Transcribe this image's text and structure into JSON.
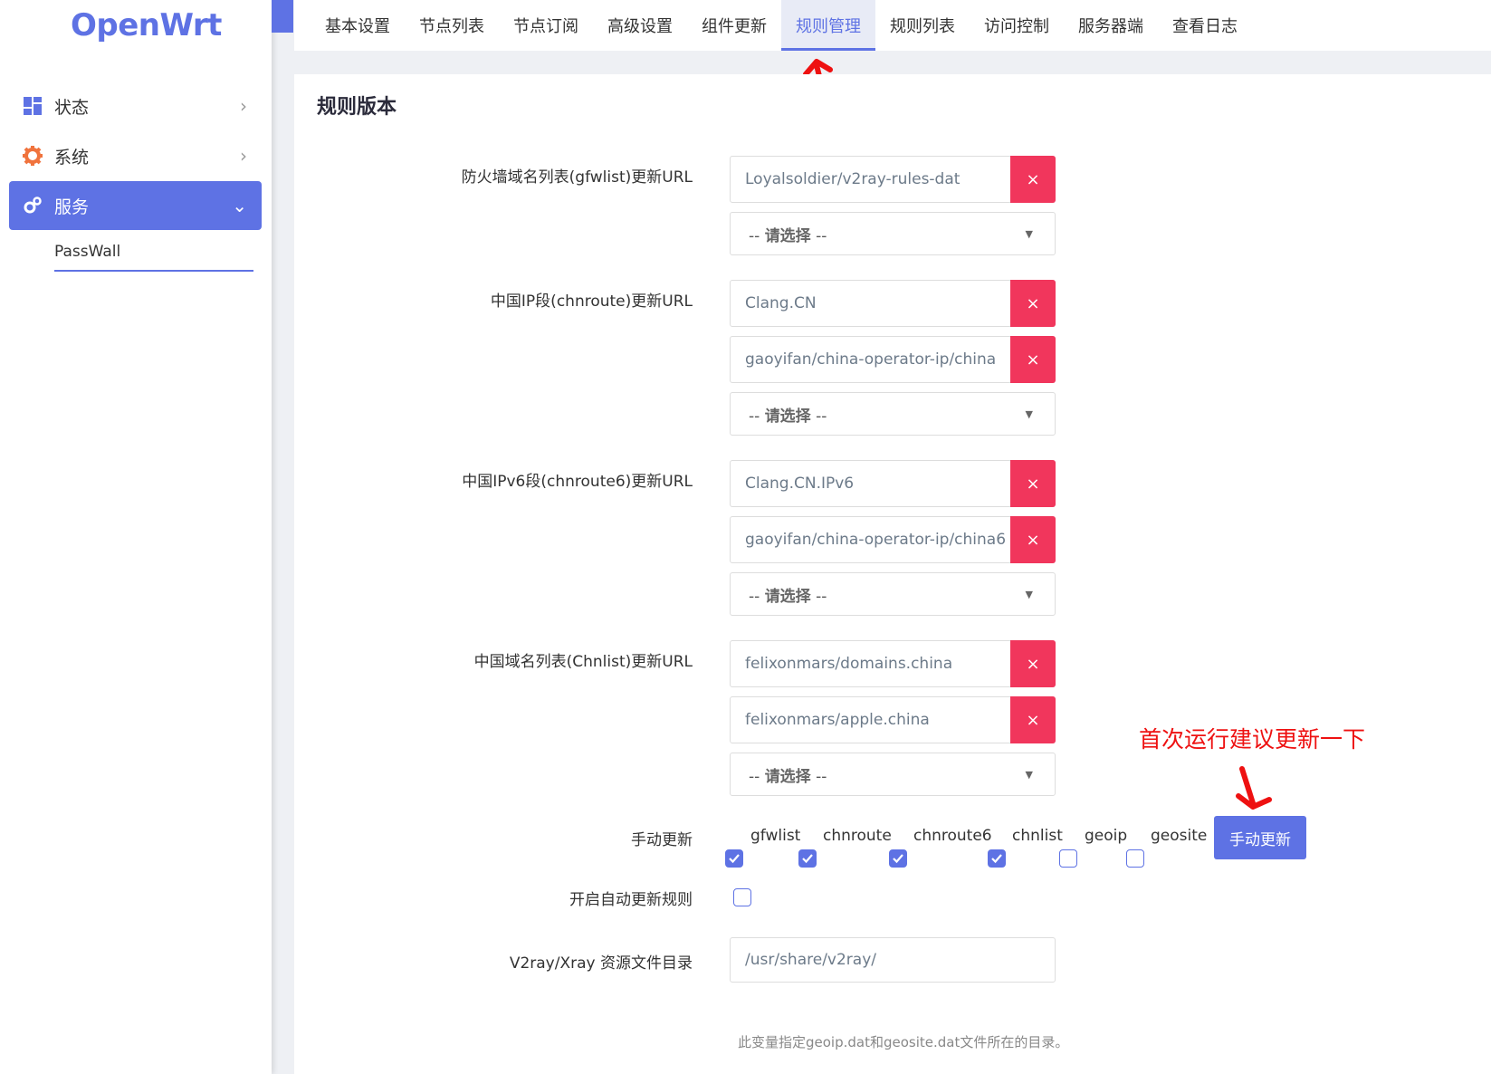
{
  "brand": {
    "logo_text": "OpenWrt",
    "accent": "#5e72e4",
    "danger": "#f1365c",
    "annotation": "#ee1111"
  },
  "sidebar": {
    "items": [
      {
        "label": "状态",
        "icon": "dashboard-icon"
      },
      {
        "label": "系统",
        "icon": "gear-icon"
      },
      {
        "label": "服务",
        "icon": "cogs-icon",
        "active": true
      }
    ],
    "sub_item": "PassWall"
  },
  "tabs": [
    {
      "label": "基本设置"
    },
    {
      "label": "节点列表"
    },
    {
      "label": "节点订阅"
    },
    {
      "label": "高级设置"
    },
    {
      "label": "组件更新"
    },
    {
      "label": "规则管理",
      "active": true
    },
    {
      "label": "规则列表"
    },
    {
      "label": "访问控制"
    },
    {
      "label": "服务器端"
    },
    {
      "label": "查看日志"
    }
  ],
  "main": {
    "section_title": "规则版本",
    "gfwlist": {
      "label": "防火墙域名列表(gfwlist)更新URL",
      "entries": [
        "Loyalsoldier/v2ray-rules-dat"
      ]
    },
    "chnroute": {
      "label": "中国IP段(chnroute)更新URL",
      "entries": [
        "Clang.CN",
        "gaoyifan/china-operator-ip/china"
      ]
    },
    "chnroute6": {
      "label": "中国IPv6段(chnroute6)更新URL",
      "entries": [
        "Clang.CN.IPv6",
        "gaoyifan/china-operator-ip/china6"
      ]
    },
    "chnlist": {
      "label": "中国域名列表(Chnlist)更新URL",
      "entries": [
        "felixonmars/domains.china",
        "felixonmars/apple.china"
      ]
    },
    "select_prefix": "--",
    "select_text": "请选择",
    "select_suffix": "--",
    "delete_symbol": "×",
    "manual_update": {
      "label": "手动更新",
      "options": [
        {
          "label": "gfwlist",
          "checked": true
        },
        {
          "label": "chnroute",
          "checked": true
        },
        {
          "label": "chnroute6",
          "checked": true
        },
        {
          "label": "chnlist",
          "checked": true
        },
        {
          "label": "geoip",
          "checked": false
        },
        {
          "label": "geosite",
          "checked": false
        }
      ],
      "button": "手动更新"
    },
    "auto_update": {
      "label": "开启自动更新规则",
      "checked": false
    },
    "asset_dir": {
      "label": "V2ray/Xray 资源文件目录",
      "value": "/usr/share/v2ray/",
      "hint": "此变量指定geoip.dat和geosite.dat文件所在的目录。"
    }
  },
  "annotation": {
    "text": "首次运行建议更新一下"
  }
}
